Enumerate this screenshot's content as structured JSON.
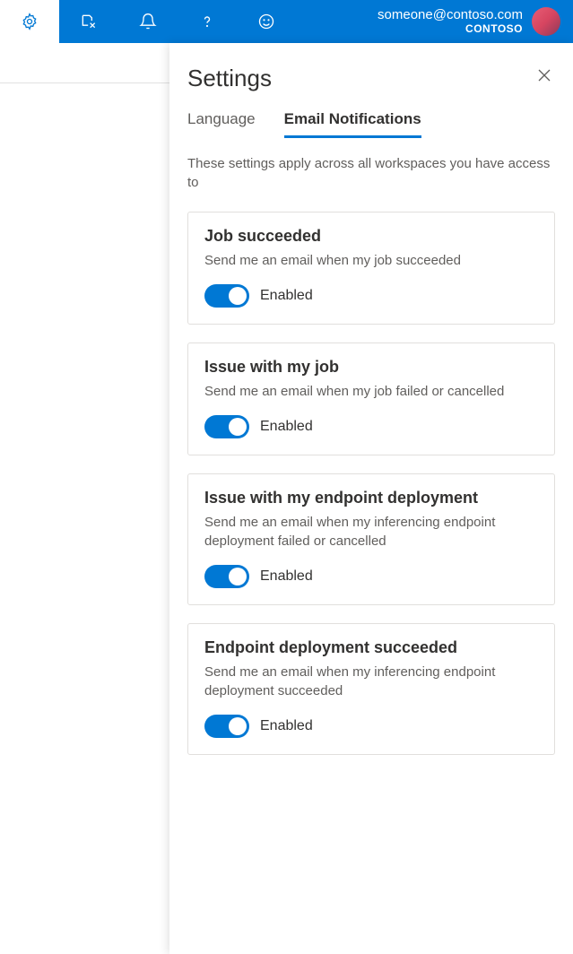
{
  "header": {
    "user_email": "someone@contoso.com",
    "org": "CONTOSO"
  },
  "panel": {
    "title": "Settings",
    "tabs": [
      {
        "label": "Language",
        "active": false
      },
      {
        "label": "Email Notifications",
        "active": true
      }
    ],
    "description": "These settings apply across all workspaces you have access to",
    "cards": [
      {
        "title": "Job succeeded",
        "desc": "Send me an email when my job succeeded",
        "toggle_label": "Enabled",
        "enabled": true
      },
      {
        "title": "Issue with my job",
        "desc": "Send me an email when my job failed or cancelled",
        "toggle_label": "Enabled",
        "enabled": true
      },
      {
        "title": "Issue with my endpoint deployment",
        "desc": "Send me an email when my inferencing endpoint deployment failed or cancelled",
        "toggle_label": "Enabled",
        "enabled": true
      },
      {
        "title": "Endpoint deployment succeeded",
        "desc": "Send me an email when my inferencing endpoint deployment succeeded",
        "toggle_label": "Enabled",
        "enabled": true
      }
    ]
  }
}
